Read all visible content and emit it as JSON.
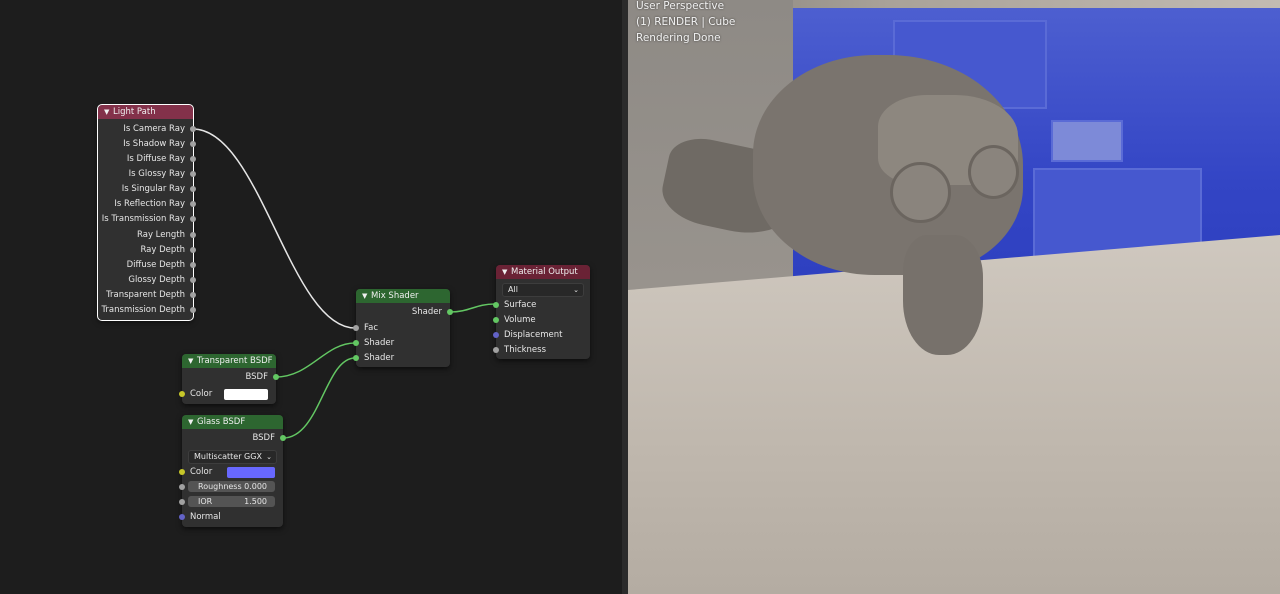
{
  "node_editor": {
    "nodes": {
      "light_path": {
        "title": "Light Path",
        "outputs": [
          "Is Camera Ray",
          "Is Shadow Ray",
          "Is Diffuse Ray",
          "Is Glossy Ray",
          "Is Singular Ray",
          "Is Reflection Ray",
          "Is Transmission Ray",
          "Ray Length",
          "Ray Depth",
          "Diffuse Depth",
          "Glossy Depth",
          "Transparent Depth",
          "Transmission Depth"
        ]
      },
      "mix_shader": {
        "title": "Mix Shader",
        "output": "Shader",
        "inputs": [
          "Fac",
          "Shader",
          "Shader"
        ]
      },
      "material_output": {
        "title": "Material Output",
        "target": "All",
        "inputs": [
          "Surface",
          "Volume",
          "Displacement",
          "Thickness"
        ]
      },
      "transparent_bsdf": {
        "title": "Transparent BSDF",
        "output": "BSDF",
        "color_label": "Color",
        "color": "#ffffff"
      },
      "glass_bsdf": {
        "title": "Glass BSDF",
        "output": "BSDF",
        "distribution": "Multiscatter GGX",
        "color_label": "Color",
        "color": "#6868ff",
        "roughness_label": "Roughness",
        "roughness": "0.000",
        "ior_label": "IOR",
        "ior": "1.500",
        "normal_label": "Normal"
      }
    }
  },
  "viewport": {
    "overlay": [
      "User Perspective",
      "(1) RENDER | Cube",
      "Rendering Done"
    ]
  },
  "colors": {
    "light_path_header": "#83314a",
    "shader_header": "#2d6630",
    "output_header": "#6a2235",
    "socket_shader": "#63c763",
    "socket_float": "#a1a1a1",
    "socket_color": "#c7c729",
    "socket_vector": "#6363c7"
  }
}
